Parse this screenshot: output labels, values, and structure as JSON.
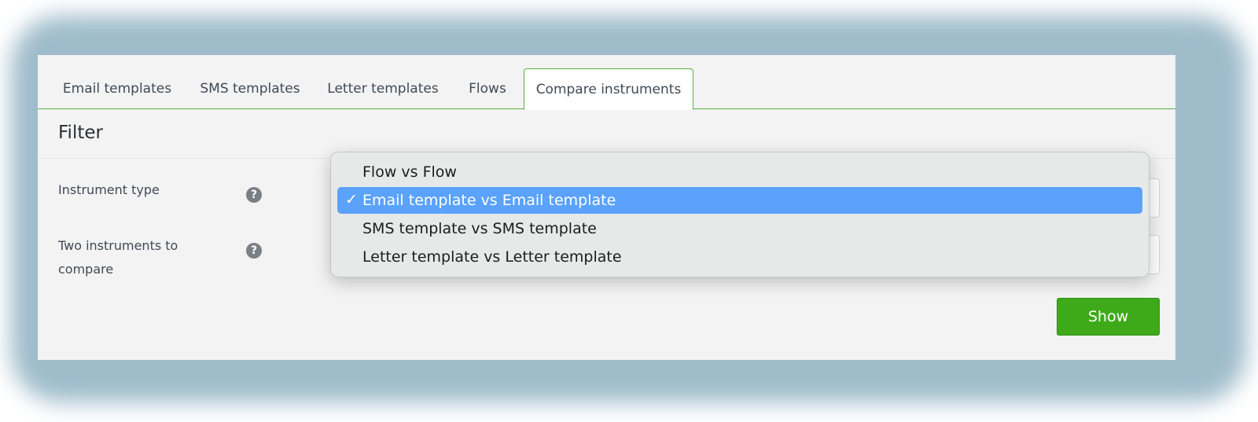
{
  "tabs": [
    {
      "label": "Email templates"
    },
    {
      "label": "SMS templates"
    },
    {
      "label": "Letter templates"
    },
    {
      "label": "Flows"
    },
    {
      "label": "Compare instruments",
      "active": true
    }
  ],
  "filter": {
    "title": "Filter",
    "instrument_type_label": "Instrument type",
    "two_instruments_label_line1": "Two instruments to",
    "two_instruments_label_line2": "compare",
    "help_glyph": "?",
    "show_button": "Show"
  },
  "dropdown": {
    "options": [
      {
        "label": "Flow vs Flow",
        "selected": false
      },
      {
        "label": "Email template vs Email template",
        "selected": true
      },
      {
        "label": "SMS template vs SMS template",
        "selected": false
      },
      {
        "label": "Letter template vs Letter template",
        "selected": false
      }
    ],
    "check_glyph": "✓"
  },
  "colors": {
    "accent_green": "#5cb23d",
    "button_green": "#3eaa19",
    "selection_blue": "#5aa2fb",
    "frame_glow": "#9fbccb"
  }
}
